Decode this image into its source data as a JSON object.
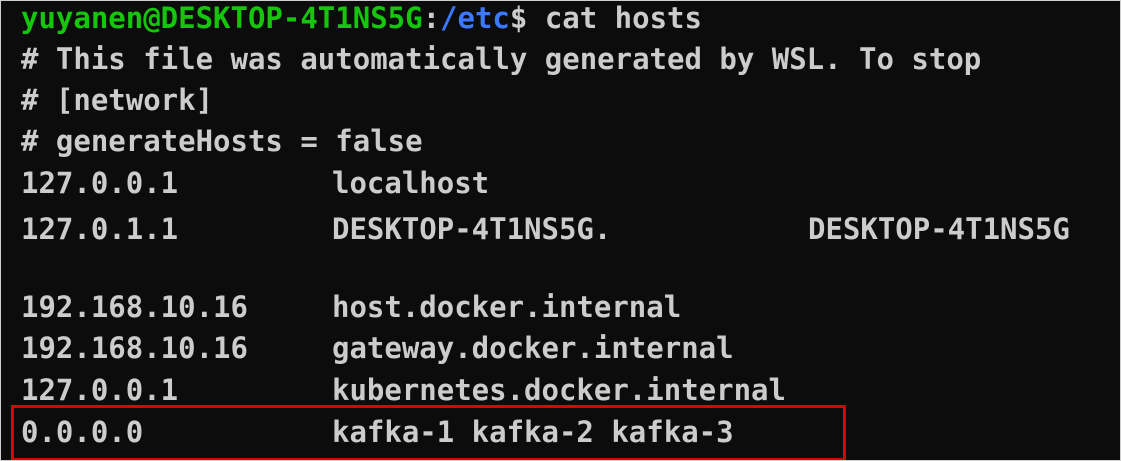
{
  "prompt": {
    "user_host": "yuyanen@DESKTOP-4T1NS5G",
    "sep": ":",
    "path": "/etc",
    "symbol": "$",
    "command": " cat hosts"
  },
  "comments": [
    "# This file was automatically generated by WSL. To stop",
    "# [network]",
    "# generateHosts = false"
  ],
  "hosts": [
    {
      "ip": "127.0.0.1",
      "names": "localhost",
      "alias": ""
    },
    {
      "ip": "127.0.1.1",
      "names": "DESKTOP-4T1NS5G.",
      "alias": "DESKTOP-4T1NS5G"
    },
    {
      "ip": "192.168.10.16",
      "names": "host.docker.internal",
      "alias": ""
    },
    {
      "ip": "192.168.10.16",
      "names": "gateway.docker.internal",
      "alias": ""
    },
    {
      "ip": "127.0.0.1",
      "names": "kubernetes.docker.internal",
      "alias": ""
    },
    {
      "ip": "0.0.0.0",
      "names": "kafka-1 kafka-2 kafka-3",
      "alias": ""
    }
  ],
  "colors": {
    "background": "#0c0c0c",
    "text": "#cccccc",
    "user_host": "#16c60c",
    "path": "#3b78ff",
    "highlight": "#e00000"
  }
}
